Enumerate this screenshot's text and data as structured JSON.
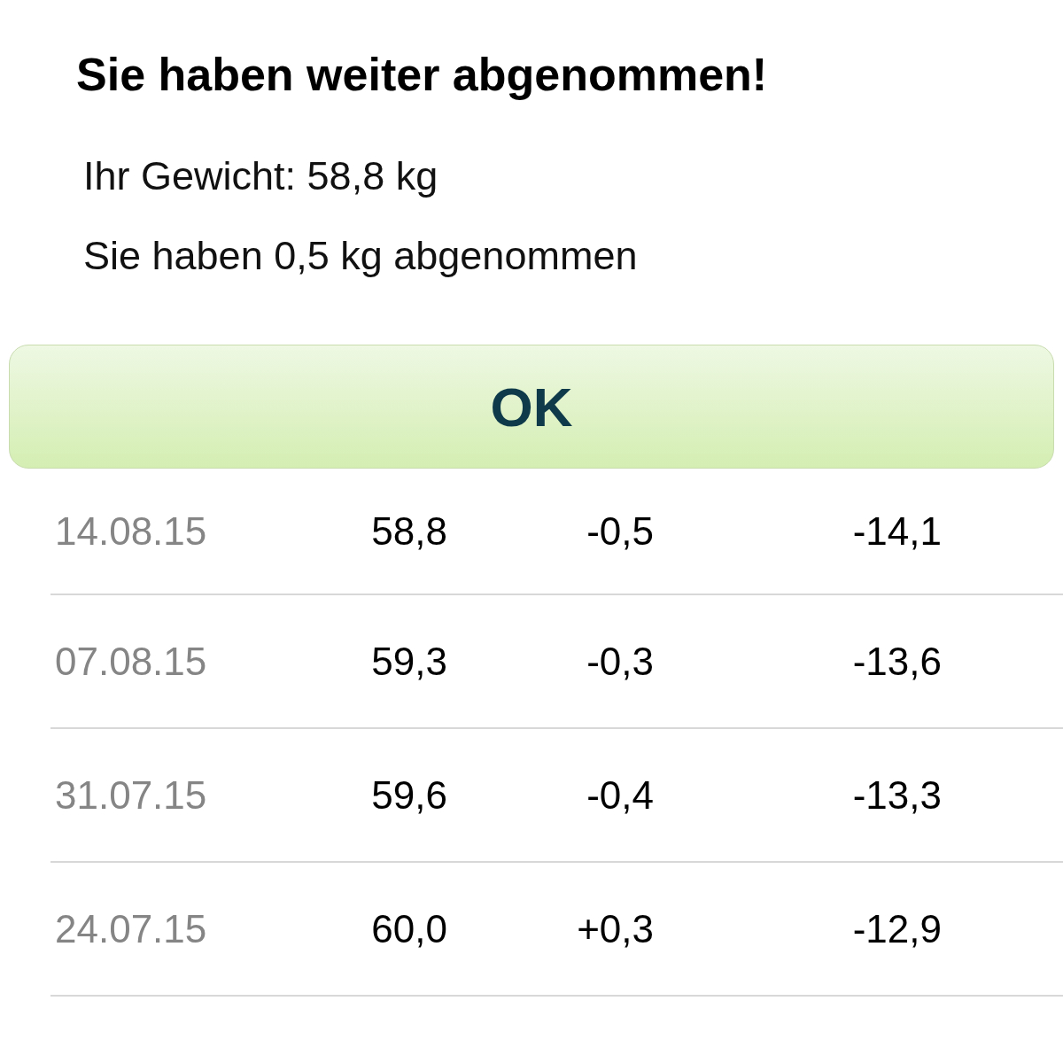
{
  "dialog": {
    "title": "Sie haben weiter abgenommen!",
    "lines": [
      "Ihr Gewicht: 58,8 kg",
      "Sie haben 0,5 kg abgenommen"
    ],
    "button": "OK"
  },
  "table": {
    "rows": [
      {
        "date": "14.08.15",
        "weight": "58,8",
        "change": "-0,5",
        "total": "-14,1"
      },
      {
        "date": "07.08.15",
        "weight": "59,3",
        "change": "-0,3",
        "total": "-13,6"
      },
      {
        "date": "31.07.15",
        "weight": "59,6",
        "change": "-0,4",
        "total": "-13,3"
      },
      {
        "date": "24.07.15",
        "weight": "60,0",
        "change": "+0,3",
        "total": "-12,9"
      }
    ]
  }
}
